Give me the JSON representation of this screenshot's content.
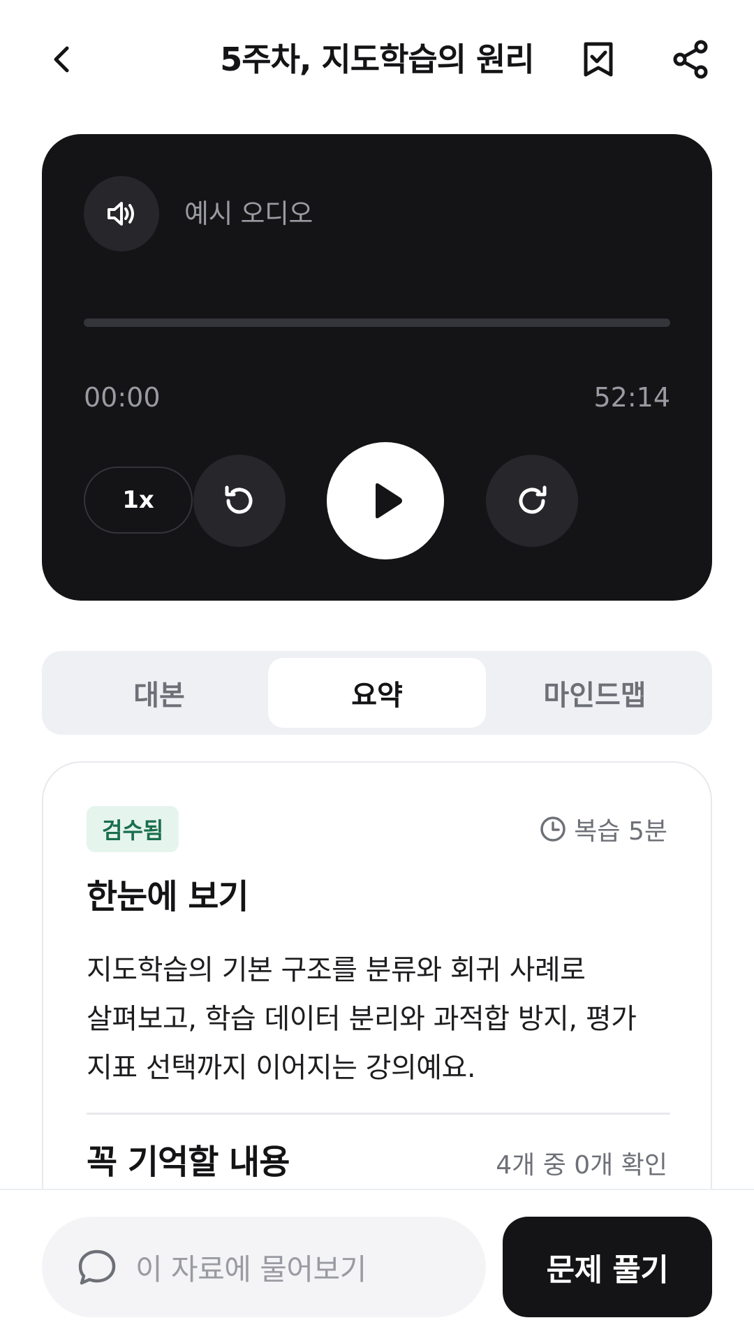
{
  "header": {
    "title": "5주차, 지도학습의 원리",
    "back_icon": "chevron-left-icon",
    "bookmark_icon": "bookmark-check-icon",
    "share_icon": "share-icon"
  },
  "player": {
    "audio_label": "예시 오디오",
    "current_time": "00:00",
    "total_time": "52:14",
    "progress": 0,
    "speed": "1x",
    "icons": {
      "volume": "speaker-icon",
      "rewind": "rewind-icon",
      "play": "play-icon",
      "forward": "forward-icon"
    }
  },
  "tabs": [
    {
      "label": "대본",
      "active": false
    },
    {
      "label": "요약",
      "active": true
    },
    {
      "label": "마인드맵",
      "active": false
    }
  ],
  "summary": {
    "badge": "검수됨",
    "review_time": "복습 5분",
    "heading": "한눈에 보기",
    "body_lines": [
      "지도학습의 기본 구조를 분류와 회귀 사례로",
      "살펴보고, 학습 데이터 분리와 과적합 방지, 평가",
      "지표 선택까지 이어지는 강의예요."
    ],
    "section_heading": "꼭 기억할 내용",
    "check_count": "4개 중 0개 확인"
  },
  "bottom": {
    "ask_placeholder": "이 자료에 물어보기",
    "solve_label": "문제 풀기"
  },
  "colors": {
    "player_bg": "#141416",
    "badge_bg": "#e6f4ee",
    "badge_text": "#1a6f4c",
    "tab_bg": "#eef0f4"
  }
}
